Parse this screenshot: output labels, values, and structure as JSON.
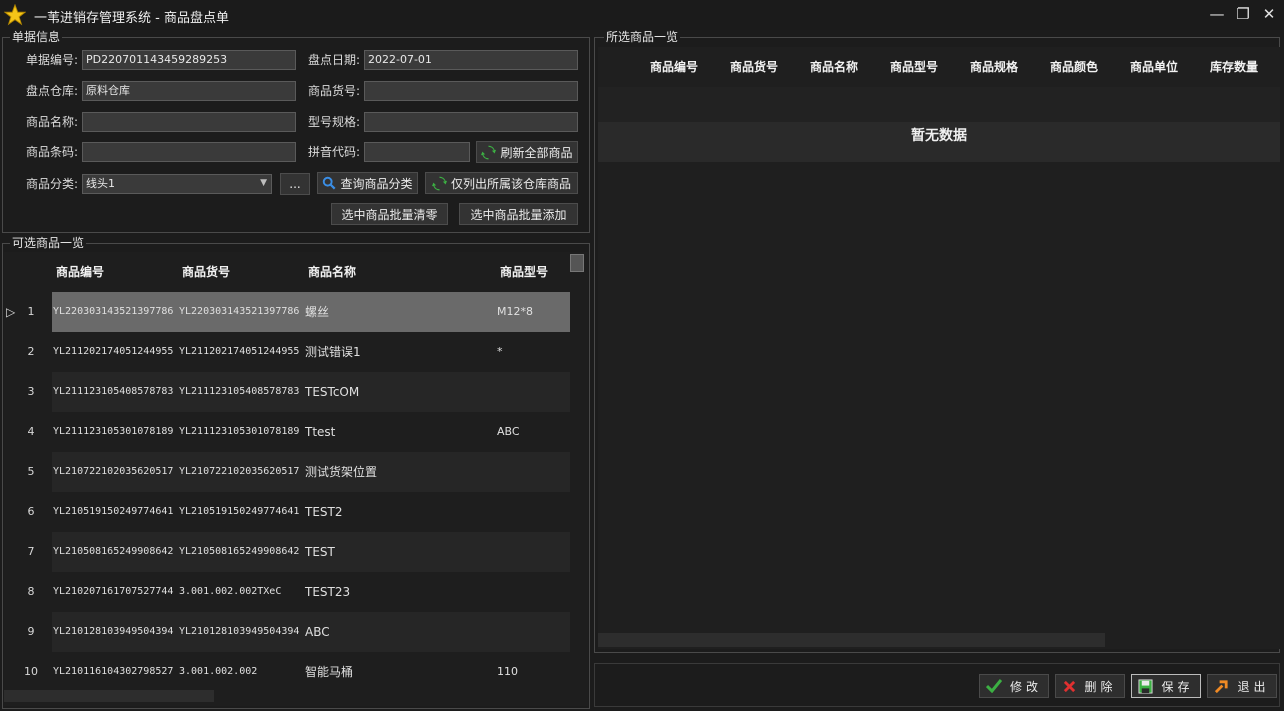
{
  "window": {
    "title": "一苇进销存管理系统 - 商品盘点单",
    "minimize": "—",
    "restore": "❐",
    "close": "✕"
  },
  "doc_info": {
    "group_title": "单据信息",
    "fields": {
      "doc_no": {
        "label": "单据编号:",
        "value": "PD220701143459289253"
      },
      "check_date": {
        "label": "盘点日期:",
        "value": "2022-07-01"
      },
      "warehouse": {
        "label": "盘点仓库:",
        "value": "原料仓库"
      },
      "item_sku": {
        "label": "商品货号:",
        "value": ""
      },
      "item_name": {
        "label": "商品名称:",
        "value": ""
      },
      "model_spec": {
        "label": "型号规格:",
        "value": ""
      },
      "barcode": {
        "label": "商品条码:",
        "value": ""
      },
      "pinyin": {
        "label": "拼音代码:",
        "value": ""
      },
      "category": {
        "label": "商品分类:",
        "value": "线头1"
      }
    },
    "buttons": {
      "refresh_all": "刷新全部商品",
      "ellipsis": "...",
      "query_category": "查询商品分类",
      "list_warehouse": "仅列出所属该仓库商品",
      "batch_clear": "选中商品批量清零",
      "batch_add": "选中商品批量添加"
    }
  },
  "available": {
    "group_title": "可选商品一览",
    "columns": [
      "商品编号",
      "商品货号",
      "商品名称",
      "商品型号"
    ],
    "selected_marker": "▷",
    "rows": [
      {
        "n": "1",
        "code": "YL220303143521397786",
        "sku": "YL220303143521397786",
        "name": "螺丝",
        "model": "M12*8"
      },
      {
        "n": "2",
        "code": "YL211202174051244955",
        "sku": "YL211202174051244955",
        "name": "测试错误1",
        "model": "*"
      },
      {
        "n": "3",
        "code": "YL211123105408578783",
        "sku": "YL211123105408578783",
        "name": "TESTcOM",
        "model": ""
      },
      {
        "n": "4",
        "code": "YL211123105301078189",
        "sku": "YL211123105301078189",
        "name": "Ttest",
        "model": "ABC"
      },
      {
        "n": "5",
        "code": "YL210722102035620517",
        "sku": "YL210722102035620517",
        "name": "测试货架位置",
        "model": ""
      },
      {
        "n": "6",
        "code": "YL210519150249774641",
        "sku": "YL210519150249774641",
        "name": "TEST2",
        "model": ""
      },
      {
        "n": "7",
        "code": "YL210508165249908642",
        "sku": "YL210508165249908642",
        "name": "TEST",
        "model": ""
      },
      {
        "n": "8",
        "code": "YL210207161707527744",
        "sku": "3.001.002.002TXeC",
        "name": "TEST23",
        "model": ""
      },
      {
        "n": "9",
        "code": "YL210128103949504394",
        "sku": "YL210128103949504394",
        "name": "ABC",
        "model": ""
      },
      {
        "n": "10",
        "code": "YL210116104302798527",
        "sku": "3.001.002.002",
        "name": "智能马桶",
        "model": "110"
      }
    ]
  },
  "selected": {
    "group_title": "所选商品一览",
    "columns": [
      "商品编号",
      "商品货号",
      "商品名称",
      "商品型号",
      "商品规格",
      "商品颜色",
      "商品单位",
      "库存数量"
    ],
    "empty_text": "暂无数据"
  },
  "actions": {
    "edit": "修改",
    "delete": "删除",
    "save": "保存",
    "exit": "退出"
  },
  "colors": {
    "accent_green": "#3cb043",
    "delete_red": "#e03030",
    "exit_orange": "#f08a24",
    "search_blue": "#3a8ee6"
  }
}
